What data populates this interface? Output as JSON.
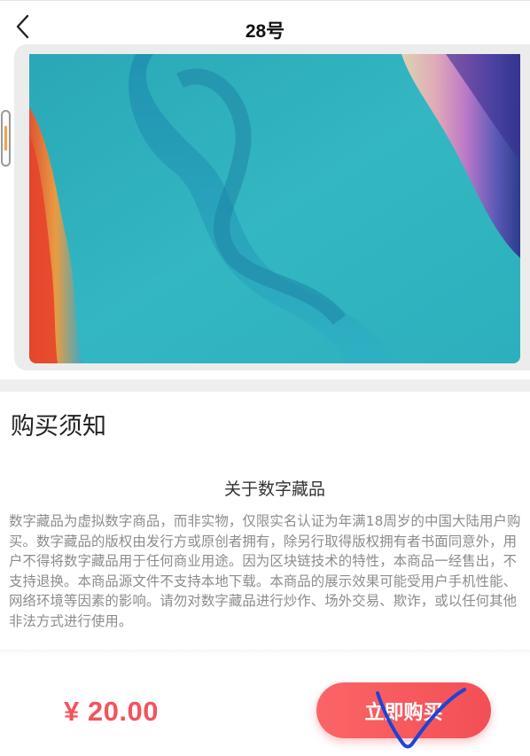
{
  "header": {
    "title": "28号",
    "back_icon": "chevron-left-icon"
  },
  "notice": {
    "heading": "购买须知",
    "subtitle": "关于数字藏品",
    "body": "数字藏品为虚拟数字商品，而非实物，仅限实名认证为年满18周岁的中国大陆用户购买。数字藏品的版权由发行方或原创者拥有，除另行取得版权拥有者书面同意外，用户不得将数字藏品用于任何商业用途。因为区块链技术的特性，本商品一经售出，不支持退换。本商品源文件不支持本地下载。本商品的展示效果可能受用户手机性能、网络环境等因素的影响。请勿对数字藏品进行炒作、场外交易、欺诈，或以任何其他非法方式进行使用。"
  },
  "footer": {
    "price": "¥ 20.00",
    "buy_label": "立即购买"
  },
  "colors": {
    "accent": "#f2545b",
    "button_gradient_start": "#fb6567",
    "button_gradient_end": "#f24f56",
    "annotation_stroke": "#1a45d6"
  }
}
